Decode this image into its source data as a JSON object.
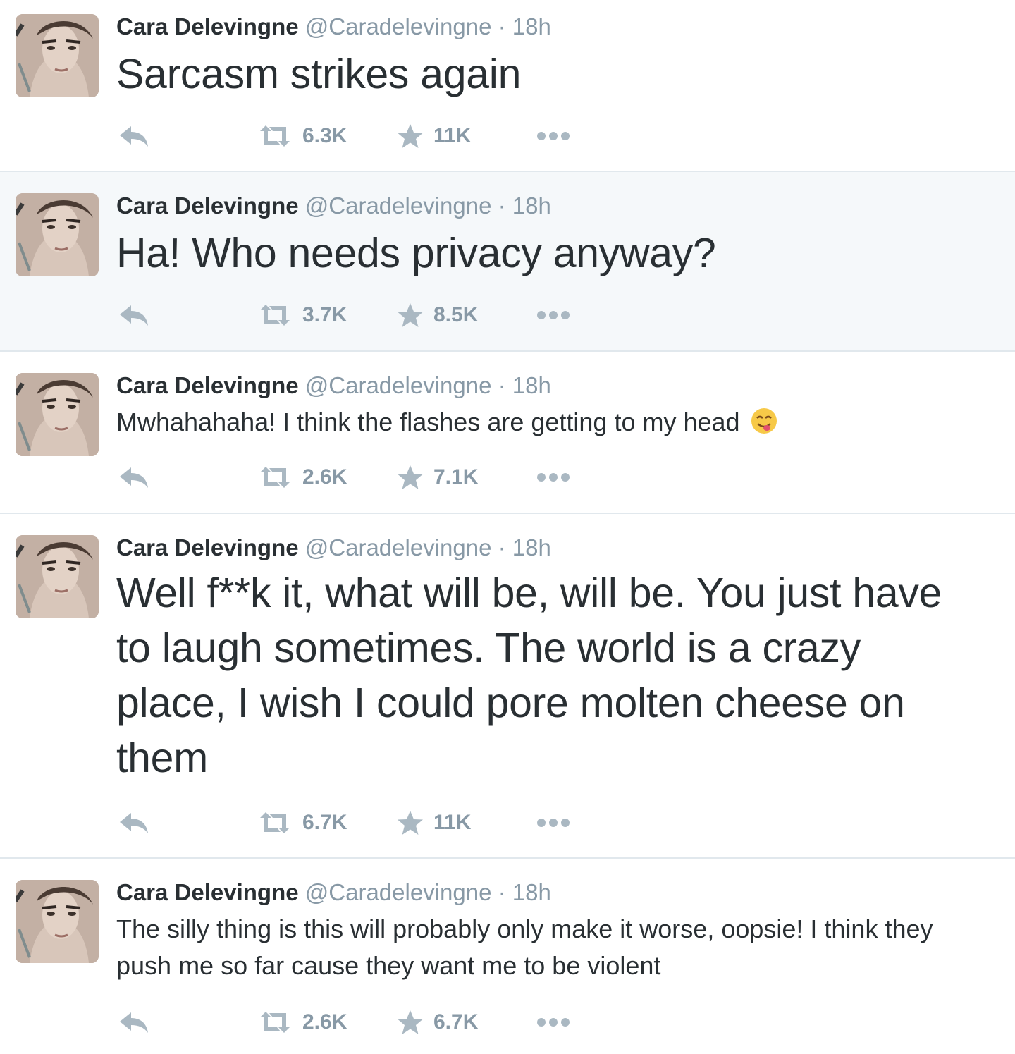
{
  "tweets": [
    {
      "name": "Cara Delevingne",
      "handle": "@Caradelevingne",
      "sep": "·",
      "time": "18h",
      "text": "Sarcasm strikes again",
      "retweets": "6.3K",
      "favorites": "11K"
    },
    {
      "name": "Cara Delevingne",
      "handle": "@Caradelevingne",
      "sep": "·",
      "time": "18h",
      "text": "Ha! Who needs privacy anyway?",
      "retweets": "3.7K",
      "favorites": "8.5K"
    },
    {
      "name": "Cara Delevingne",
      "handle": "@Caradelevingne",
      "sep": "·",
      "time": "18h",
      "text": "Mwhahahaha! I think the flashes are getting to my head",
      "emoji": "savoring-food-emoji",
      "retweets": "2.6K",
      "favorites": "7.1K"
    },
    {
      "name": "Cara Delevingne",
      "handle": "@Caradelevingne",
      "sep": "·",
      "time": "18h",
      "text": "Well f**k it, what will be, will be. You just have to laugh sometimes. The world is a crazy place, I wish I could pore molten cheese on them",
      "retweets": "6.7K",
      "favorites": "11K"
    },
    {
      "name": "Cara Delevingne",
      "handle": "@Caradelevingne",
      "sep": "·",
      "time": "18h",
      "text": "The silly thing is this will probably only make it worse, oopsie! I think they push me so far cause they want me to be violent",
      "retweets": "2.6K",
      "favorites": "6.7K"
    }
  ],
  "icons": {
    "reply": "reply-icon",
    "retweet": "retweet-icon",
    "favorite": "star-icon",
    "more": "more-icon"
  },
  "colors": {
    "text": "#292f33",
    "muted": "#8899a6",
    "icon": "#aab8c2",
    "divider": "#e1e8ed",
    "highlight_bg": "#f5f8fa"
  }
}
